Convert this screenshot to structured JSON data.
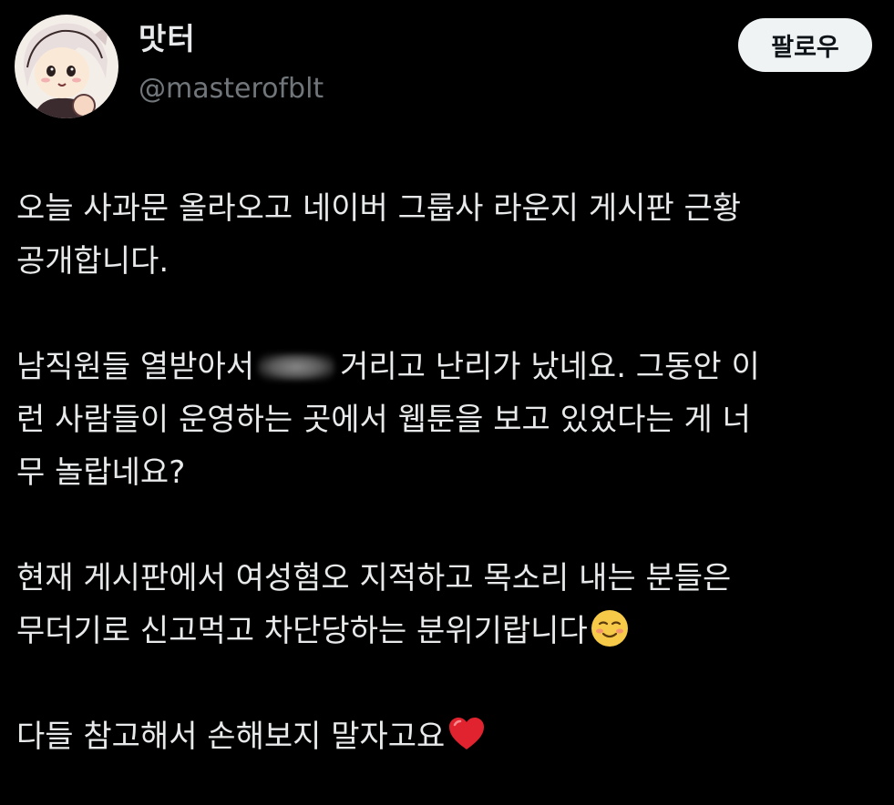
{
  "author": {
    "display_name": "맛터",
    "handle": "@masterofblt",
    "avatar_icon": "anime-girl-avatar"
  },
  "follow_button": {
    "label": "팔로우"
  },
  "tweet": {
    "p1": {
      "line1": "오늘 사과문 올라오고 네이버 그룹사 라운지 게시판 근황",
      "line2": "공개합니다."
    },
    "p2": {
      "line1_start": "남직원들 열받아서",
      "line1_end": "거리고 난리가 났네요. 그동안 이",
      "line2": "런 사람들이 운영하는 곳에서 웹툰을 보고 있었다는 게 너",
      "line3": "무 놀랍네요?"
    },
    "p3": {
      "line1": "현재 게시판에서 여성혐오 지적하고 목소리 내는 분들은",
      "line2": "무더기로 신고먹고 차단당하는 분위기랍니다",
      "emoji": "smiling-face-emoji"
    },
    "p4": {
      "line1": "다들 참고해서 손해보지 말자고요",
      "emoji": "red-heart-emoji"
    }
  },
  "colors": {
    "background": "#000000",
    "text_primary": "#e7e9ea",
    "text_secondary": "#71767b",
    "button_bg": "#eff3f4",
    "button_text": "#0f1419"
  }
}
